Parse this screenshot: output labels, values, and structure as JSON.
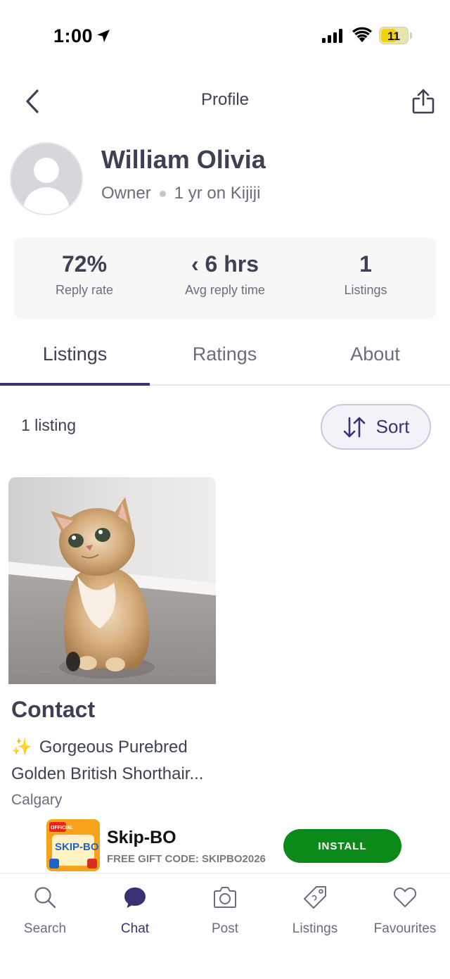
{
  "status_bar": {
    "time": "1:00",
    "battery": "11"
  },
  "header": {
    "title": "Profile"
  },
  "profile": {
    "name": "William Olivia",
    "role": "Owner",
    "tenure": "1 yr on Kijiji"
  },
  "stats": [
    {
      "value": "72%",
      "label": "Reply rate"
    },
    {
      "value": "‹ 6 hrs",
      "label": "Avg reply time"
    },
    {
      "value": "1",
      "label": "Listings"
    }
  ],
  "tabs": [
    {
      "label": "Listings",
      "active": true
    },
    {
      "label": "Ratings",
      "active": false
    },
    {
      "label": "About",
      "active": false
    }
  ],
  "listings_bar": {
    "count_text": "1 listing",
    "sort_label": "Sort"
  },
  "listing": {
    "price": "Contact",
    "title": "Gorgeous Purebred Golden British Shorthair...",
    "sparkle": "✨",
    "location": "Calgary"
  },
  "ad": {
    "title": "Skip-BO",
    "subtitle": "FREE GIFT CODE: SKIPBO2026",
    "install_label": "INSTALL",
    "logo_text": "SKIP-BO",
    "logo_badge": "OFFICIAL"
  },
  "bottom_nav": [
    {
      "label": "Search",
      "icon": "search-icon",
      "active": false
    },
    {
      "label": "Chat",
      "icon": "chat-icon",
      "active": true
    },
    {
      "label": "Post",
      "icon": "camera-icon",
      "active": false
    },
    {
      "label": "Listings",
      "icon": "tag-icon",
      "active": false
    },
    {
      "label": "Favourites",
      "icon": "heart-icon",
      "active": false
    }
  ],
  "colors": {
    "accent": "#373373",
    "text": "#3e4153",
    "muted": "#6b6d7c",
    "install": "#0b8a1a"
  }
}
